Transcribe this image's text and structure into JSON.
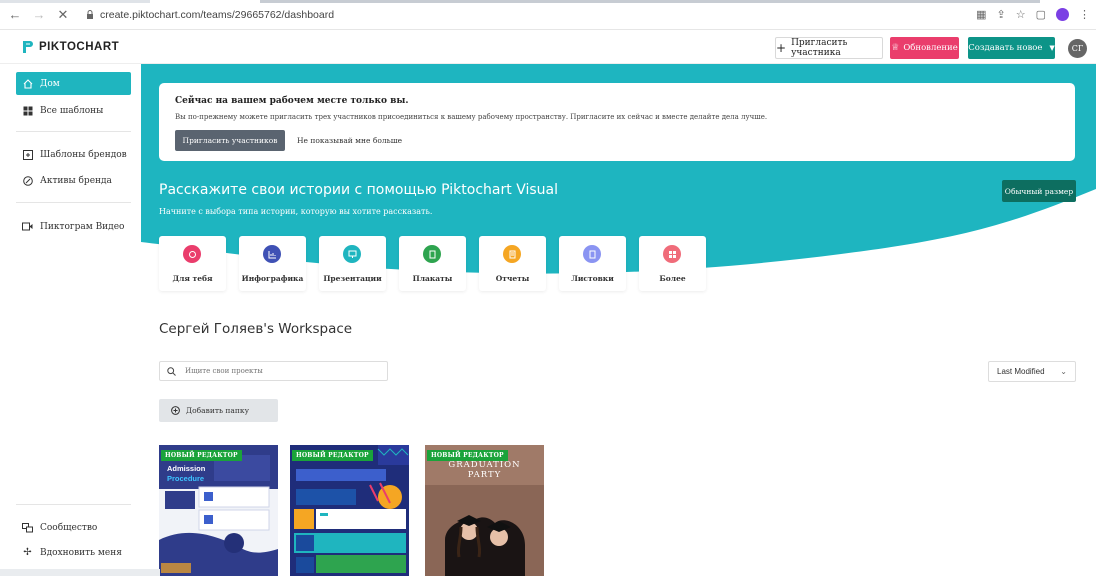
{
  "browser": {
    "url": "create.piktochart.com/teams/29665762/dashboard"
  },
  "brand": {
    "logo_text": "PIKTOCHART",
    "accent": "#1fb5bf",
    "pink": "#ea3d6c",
    "green": "#0d9488"
  },
  "header": {
    "invite_label": "Пригласить участника",
    "upgrade_label": "Обновление",
    "create_label": "Создавать новое",
    "avatar_initials": "СГ"
  },
  "sidebar": {
    "items": [
      {
        "label": "Дом",
        "icon": "home-icon"
      },
      {
        "label": "Все шаблоны",
        "icon": "grid-icon"
      },
      {
        "label": "Шаблоны брендов",
        "icon": "brand-templates-icon"
      },
      {
        "label": "Активы бренда",
        "icon": "brand-assets-icon"
      },
      {
        "label": "Пиктограм Видео",
        "icon": "video-icon"
      },
      {
        "label": "Сообщество",
        "icon": "community-icon"
      },
      {
        "label": "Вдохновить меня",
        "icon": "sparkle-icon"
      }
    ]
  },
  "notice": {
    "title": "Сейчас на вашем рабочем месте только вы.",
    "text": "Вы по-прежнему можете пригласить трех участников присоединиться к вашему рабочему пространству. Пригласите их сейчас и вместе делайте дела лучше.",
    "invite_button": "Пригласить участников",
    "hide_link": "Не показывай мне больше"
  },
  "hero": {
    "title": "Расскажите свои истории с помощью Piktochart Visual",
    "subtitle": "Начните с выбора типа истории, которую вы хотите рассказать.",
    "size_button": "Обычный размер",
    "categories": [
      {
        "label": "Для тебя",
        "color": "#ea3d6c"
      },
      {
        "label": "Инфографика",
        "color": "#3f51b5"
      },
      {
        "label": "Презентации",
        "color": "#1fb5bf"
      },
      {
        "label": "Плакаты",
        "color": "#2ea44f"
      },
      {
        "label": "Отчеты",
        "color": "#f5a623"
      },
      {
        "label": "Листовки",
        "color": "#8a94f2"
      },
      {
        "label": "Более",
        "color": "#f06c7a"
      }
    ]
  },
  "workspace": {
    "title": "Сергей Голяев's Workspace",
    "search_placeholder": "Ищите свои проекты",
    "sort_label": "Last Modified",
    "add_folder_label": "Добавить папку"
  },
  "projects": [
    {
      "badge": "НОВЫЙ РЕДАКТОР",
      "title_line1": "Admission",
      "title_line2": "Procedure"
    },
    {
      "badge": "НОВЫЙ РЕДАКТОР"
    },
    {
      "badge": "НОВЫЙ РЕДАКТОР",
      "title_line1": "GRADUATION",
      "title_line2": "PARTY"
    }
  ]
}
